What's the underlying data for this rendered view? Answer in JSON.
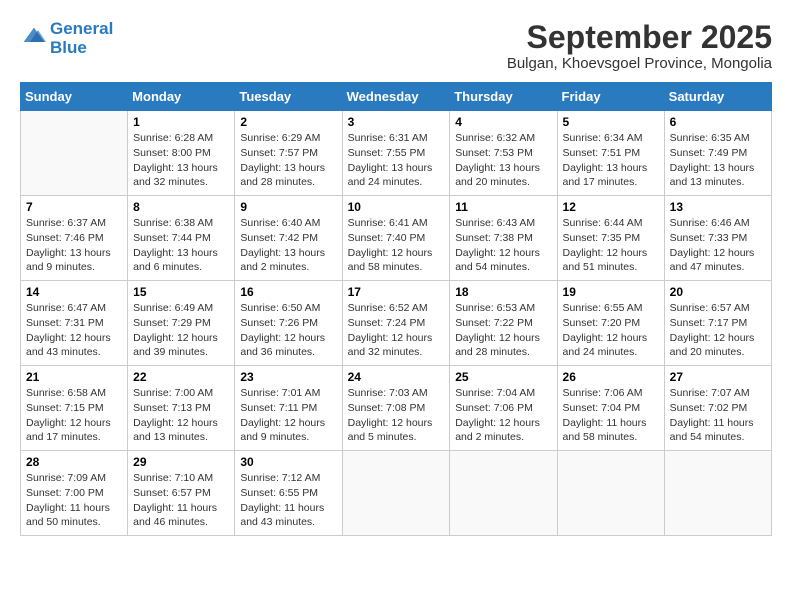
{
  "header": {
    "logo_line1": "General",
    "logo_line2": "Blue",
    "month_title": "September 2025",
    "location": "Bulgan, Khoevsgoel Province, Mongolia"
  },
  "days_of_week": [
    "Sunday",
    "Monday",
    "Tuesday",
    "Wednesday",
    "Thursday",
    "Friday",
    "Saturday"
  ],
  "weeks": [
    [
      {
        "num": "",
        "info": ""
      },
      {
        "num": "1",
        "info": "Sunrise: 6:28 AM\nSunset: 8:00 PM\nDaylight: 13 hours\nand 32 minutes."
      },
      {
        "num": "2",
        "info": "Sunrise: 6:29 AM\nSunset: 7:57 PM\nDaylight: 13 hours\nand 28 minutes."
      },
      {
        "num": "3",
        "info": "Sunrise: 6:31 AM\nSunset: 7:55 PM\nDaylight: 13 hours\nand 24 minutes."
      },
      {
        "num": "4",
        "info": "Sunrise: 6:32 AM\nSunset: 7:53 PM\nDaylight: 13 hours\nand 20 minutes."
      },
      {
        "num": "5",
        "info": "Sunrise: 6:34 AM\nSunset: 7:51 PM\nDaylight: 13 hours\nand 17 minutes."
      },
      {
        "num": "6",
        "info": "Sunrise: 6:35 AM\nSunset: 7:49 PM\nDaylight: 13 hours\nand 13 minutes."
      }
    ],
    [
      {
        "num": "7",
        "info": "Sunrise: 6:37 AM\nSunset: 7:46 PM\nDaylight: 13 hours\nand 9 minutes."
      },
      {
        "num": "8",
        "info": "Sunrise: 6:38 AM\nSunset: 7:44 PM\nDaylight: 13 hours\nand 6 minutes."
      },
      {
        "num": "9",
        "info": "Sunrise: 6:40 AM\nSunset: 7:42 PM\nDaylight: 13 hours\nand 2 minutes."
      },
      {
        "num": "10",
        "info": "Sunrise: 6:41 AM\nSunset: 7:40 PM\nDaylight: 12 hours\nand 58 minutes."
      },
      {
        "num": "11",
        "info": "Sunrise: 6:43 AM\nSunset: 7:38 PM\nDaylight: 12 hours\nand 54 minutes."
      },
      {
        "num": "12",
        "info": "Sunrise: 6:44 AM\nSunset: 7:35 PM\nDaylight: 12 hours\nand 51 minutes."
      },
      {
        "num": "13",
        "info": "Sunrise: 6:46 AM\nSunset: 7:33 PM\nDaylight: 12 hours\nand 47 minutes."
      }
    ],
    [
      {
        "num": "14",
        "info": "Sunrise: 6:47 AM\nSunset: 7:31 PM\nDaylight: 12 hours\nand 43 minutes."
      },
      {
        "num": "15",
        "info": "Sunrise: 6:49 AM\nSunset: 7:29 PM\nDaylight: 12 hours\nand 39 minutes."
      },
      {
        "num": "16",
        "info": "Sunrise: 6:50 AM\nSunset: 7:26 PM\nDaylight: 12 hours\nand 36 minutes."
      },
      {
        "num": "17",
        "info": "Sunrise: 6:52 AM\nSunset: 7:24 PM\nDaylight: 12 hours\nand 32 minutes."
      },
      {
        "num": "18",
        "info": "Sunrise: 6:53 AM\nSunset: 7:22 PM\nDaylight: 12 hours\nand 28 minutes."
      },
      {
        "num": "19",
        "info": "Sunrise: 6:55 AM\nSunset: 7:20 PM\nDaylight: 12 hours\nand 24 minutes."
      },
      {
        "num": "20",
        "info": "Sunrise: 6:57 AM\nSunset: 7:17 PM\nDaylight: 12 hours\nand 20 minutes."
      }
    ],
    [
      {
        "num": "21",
        "info": "Sunrise: 6:58 AM\nSunset: 7:15 PM\nDaylight: 12 hours\nand 17 minutes."
      },
      {
        "num": "22",
        "info": "Sunrise: 7:00 AM\nSunset: 7:13 PM\nDaylight: 12 hours\nand 13 minutes."
      },
      {
        "num": "23",
        "info": "Sunrise: 7:01 AM\nSunset: 7:11 PM\nDaylight: 12 hours\nand 9 minutes."
      },
      {
        "num": "24",
        "info": "Sunrise: 7:03 AM\nSunset: 7:08 PM\nDaylight: 12 hours\nand 5 minutes."
      },
      {
        "num": "25",
        "info": "Sunrise: 7:04 AM\nSunset: 7:06 PM\nDaylight: 12 hours\nand 2 minutes."
      },
      {
        "num": "26",
        "info": "Sunrise: 7:06 AM\nSunset: 7:04 PM\nDaylight: 11 hours\nand 58 minutes."
      },
      {
        "num": "27",
        "info": "Sunrise: 7:07 AM\nSunset: 7:02 PM\nDaylight: 11 hours\nand 54 minutes."
      }
    ],
    [
      {
        "num": "28",
        "info": "Sunrise: 7:09 AM\nSunset: 7:00 PM\nDaylight: 11 hours\nand 50 minutes."
      },
      {
        "num": "29",
        "info": "Sunrise: 7:10 AM\nSunset: 6:57 PM\nDaylight: 11 hours\nand 46 minutes."
      },
      {
        "num": "30",
        "info": "Sunrise: 7:12 AM\nSunset: 6:55 PM\nDaylight: 11 hours\nand 43 minutes."
      },
      {
        "num": "",
        "info": ""
      },
      {
        "num": "",
        "info": ""
      },
      {
        "num": "",
        "info": ""
      },
      {
        "num": "",
        "info": ""
      }
    ]
  ]
}
